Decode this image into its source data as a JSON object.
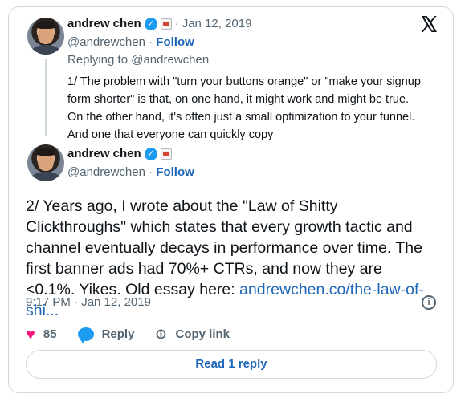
{
  "brand": {
    "logo_icon": "x-logo-icon",
    "accent": "#1d9bf0",
    "link_color": "#1d66b7",
    "like_color": "#f91880"
  },
  "parent_tweet": {
    "author_name": "andrew chen",
    "verified_icon": "verified-check-icon",
    "affiliate_badge_icon": "affiliate-badge-icon",
    "separator": "·",
    "date": "Jan 12, 2019",
    "handle": "@andrewchen",
    "handle_separator": "·",
    "follow_label": "Follow",
    "replying_to": "Replying to @andrewchen",
    "text": "1/ The problem with \"turn your buttons orange\" or \"make your signup form shorter\" is that, on one hand, it might work and might be true. On the other hand, it's often just a small optimization to your funnel. And one that everyone can quickly copy"
  },
  "main_tweet": {
    "author_name": "andrew chen",
    "verified_icon": "verified-check-icon",
    "affiliate_badge_icon": "affiliate-badge-icon",
    "handle": "@andrewchen",
    "handle_separator": "·",
    "follow_label": "Follow",
    "text": "2/ Years ago, I wrote about the \"Law of Shitty Clickthroughs\" which states that every growth tactic and channel eventually decays in performance over time. The first banner ads had 70%+ CTRs, and now they are <0.1%. Yikes. Old essay here: ",
    "link_text": "andrewchen.co/the-law-of-shi...",
    "timestamp": "9:17 PM · Jan 12, 2019",
    "info_icon": "info-icon"
  },
  "actions": {
    "like_icon": "heart-icon",
    "like_count": "85",
    "reply_icon": "reply-bubble-icon",
    "reply_label": "Reply",
    "copy_icon": "link-icon",
    "copy_label": "Copy link"
  },
  "read_replies_label": "Read 1 reply"
}
